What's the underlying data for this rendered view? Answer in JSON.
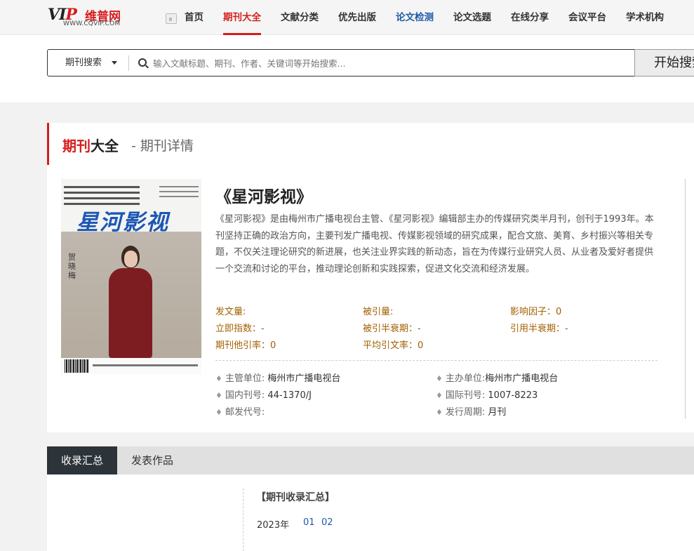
{
  "header": {
    "logo": {
      "mark_a": "V",
      "mark_b": "I",
      "mark_c": "P",
      "cn_name": "维普网",
      "url": "WWW.CQVIP.COM"
    },
    "nav": [
      {
        "label": "首页"
      },
      {
        "label": "期刊大全",
        "active": true
      },
      {
        "label": "文献分类"
      },
      {
        "label": "优先出版"
      },
      {
        "label": "论文检测",
        "color": "#1e5aa8"
      },
      {
        "label": "论文选题"
      },
      {
        "label": "在线分享"
      },
      {
        "label": "会议平台"
      },
      {
        "label": "学术机构"
      }
    ]
  },
  "search": {
    "type_label": "期刊搜索",
    "placeholder": "输入文献标题、期刊、作者、关键词等开始搜索...",
    "button_label": "开始搜索"
  },
  "page_heading": {
    "part_red": "期刊",
    "part_dark": "大全",
    "subtitle": "- 期刊详情"
  },
  "journal": {
    "title": "《星河影视》",
    "cover_name": "星河影视",
    "cover_side_text": "贺晓梅",
    "description": "《星河影视》是由梅州市广播电视台主管、《星河影视》编辑部主办的传媒研究类半月刊，创刊于1993年。本刊坚持正确的政治方向，主要刊发广播电视、传媒影视领域的研究成果，配合文旅、美育、乡村振兴等相关专题，不仅关注理论研究的新进展，也关注业界实践的新动态，旨在为传媒行业研究人员、从业者及爱好者提供一个交流和讨论的平台，推动理论创新和实践探索，促进文化交流和经济发展。",
    "metrics": {
      "fawenliang": "发文量:",
      "beiyinliang": "被引量:",
      "yingxiangyinzi": "影响因子：0",
      "lijizhishu": "立即指数：-",
      "beiyinbanshuaiqi": "被引半衰期：-",
      "yinyongbanshuaiqi": "引用半衰期：-",
      "qikantayinlv": "期刊他引率：0",
      "pingjunyinwenlv": "平均引文率：0"
    },
    "info": {
      "zhuguan_label": "主管单位:",
      "zhuguan_value": "梅州市广播电视台",
      "zhuban_label": "主办单位:",
      "zhuban_value": "梅州市广播电视台",
      "guonei_label": "国内刊号:",
      "guonei_value": "44-1370/J",
      "guoji_label": "国际刊号:",
      "guoji_value": "1007-8223",
      "youfa_label": "邮发代号:",
      "youfa_value": "",
      "zhouqi_label": "发行周期:",
      "zhouqi_value": "月刊"
    }
  },
  "tabs": [
    {
      "label": "收录汇总",
      "active": true
    },
    {
      "label": "发表作品"
    }
  ],
  "summary": {
    "title": "【期刊收录汇总】",
    "year": "2023年",
    "issues": [
      "01",
      "02"
    ]
  },
  "colors": {
    "accent": "#d71c1c",
    "link": "#1e5aa8",
    "metric": "#a25f00",
    "tab_active_bg": "#2c3339"
  }
}
